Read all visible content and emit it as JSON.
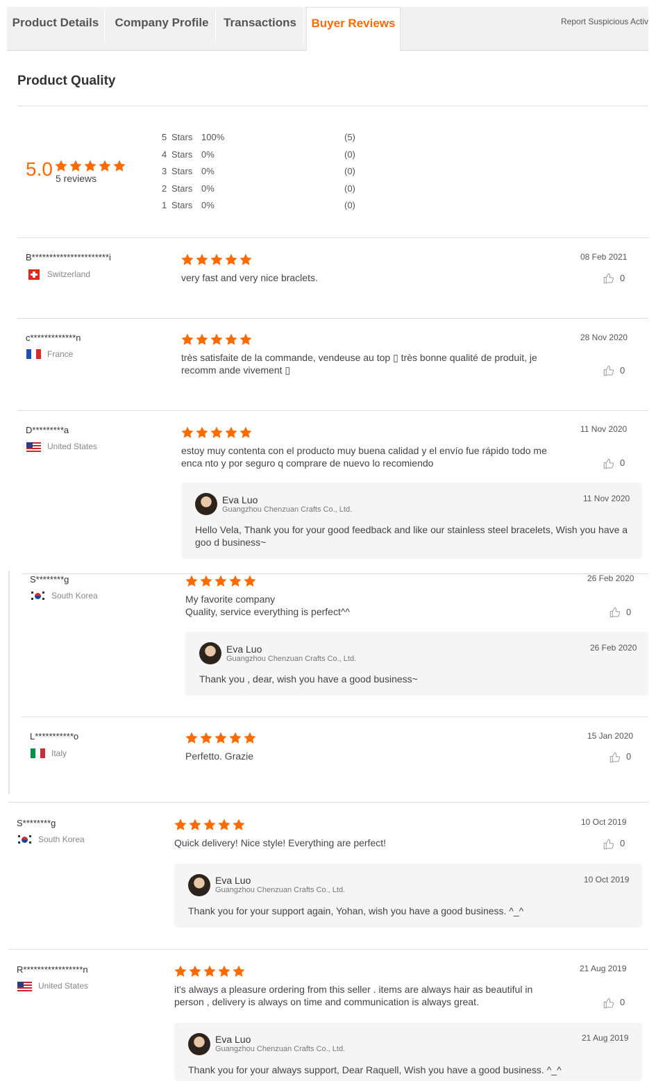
{
  "tabs": [
    {
      "label": "Product Details"
    },
    {
      "label": "Company Profile"
    },
    {
      "label": "Transactions"
    },
    {
      "label": "Buyer Reviews"
    }
  ],
  "report_label": "Report Suspicious Activity",
  "quality": {
    "title": "Product Quality",
    "average": "5.0",
    "rating_stars": 5,
    "reviews_count": "5 reviews",
    "distribution": [
      {
        "num": "5",
        "label": "Stars",
        "pct": "100%",
        "count": "(5)"
      },
      {
        "num": "4",
        "label": "Stars",
        "pct": "0%",
        "count": "(0)"
      },
      {
        "num": "3",
        "label": "Stars",
        "pct": "0%",
        "count": "(0)"
      },
      {
        "num": "2",
        "label": "Stars",
        "pct": "0%",
        "count": "(0)"
      },
      {
        "num": "1",
        "label": "Stars",
        "pct": "0%",
        "count": "(0)"
      }
    ]
  },
  "reviews": [
    {
      "name": "B**********************i",
      "country": "Switzerland",
      "date": "08 Feb 2021",
      "text": "very fast and very nice braclets.",
      "likes": "0",
      "stars": 5
    },
    {
      "name": "c*************n",
      "country": "France",
      "date": "28 Nov 2020",
      "text": "très satisfaite de la commande, vendeuse au top ▯ très bonne qualité de produit, je recomm ande vivement ▯",
      "likes": "0",
      "stars": 5
    },
    {
      "name": "D*********a",
      "country": "United States",
      "date": "11 Nov 2020",
      "text": "estoy muy contenta con el producto muy buena  calidad y el envío fue rápido  todo me enca nto y por seguro q comprare de nuevo lo recomiendo",
      "likes": "0",
      "stars": 5,
      "reply": {
        "name": "Eva Luo",
        "company": "Guangzhou Chenzuan Crafts Co., Ltd.",
        "date": "11 Nov 2020",
        "text": "Hello Vela, Thank you for your good feedback and like our stainless steel bracelets, Wish you have a goo d business~"
      }
    },
    {
      "name": "S********g",
      "country": "South Korea",
      "date": "26 Feb 2020",
      "text": "My favorite company",
      "text2": "Quality, service everything is perfect^^",
      "likes": "0",
      "stars": 5,
      "reply": {
        "name": "Eva Luo",
        "company": "Guangzhou Chenzuan Crafts Co., Ltd.",
        "date": "26 Feb 2020",
        "text": "Thank you , dear, wish you have a good business~"
      }
    },
    {
      "name": "L***********o",
      "country": "Italy",
      "date": "15 Jan 2020",
      "text": "Perfetto. Grazie",
      "likes": "0",
      "stars": 5
    },
    {
      "name": "S********g",
      "country": "South Korea",
      "date": "10 Oct 2019",
      "text": "Quick delivery! Nice style! Everything are perfect!",
      "likes": "0",
      "stars": 5,
      "reply": {
        "name": "Eva Luo",
        "company": "Guangzhou Chenzuan Crafts Co., Ltd.",
        "date": "10 Oct 2019",
        "text": "Thank you for your support again, Yohan, wish you have a good business. ^_^"
      }
    },
    {
      "name": "R*****************n",
      "country": "United States",
      "date": "21 Aug 2019",
      "text": "it's always a pleasure ordering from this seller . items are always hair as beautiful  in person , delivery is always on time and communication is always great.",
      "likes": "0",
      "stars": 5,
      "reply": {
        "name": "Eva Luo",
        "company": "Guangzhou Chenzuan Crafts Co., Ltd.",
        "date": "21 Aug 2019",
        "text": "Thank you for your always support, Dear Raquell, Wish you have a good business. ^_^"
      }
    }
  ],
  "colors": {
    "accent": "#ff6a00"
  }
}
